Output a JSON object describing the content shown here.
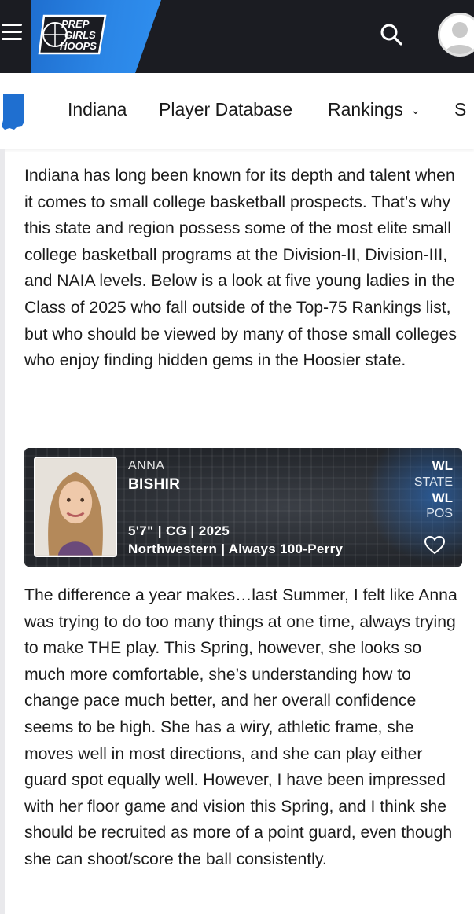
{
  "header": {
    "logo_lines": [
      "PREP",
      "GIRLS",
      "HOOPS"
    ],
    "icons": {
      "menu": "hamburger-menu-icon",
      "search": "search-icon",
      "account": "user-avatar-icon"
    },
    "colors": {
      "bar": "#1b1c22",
      "accent": "#2b86e6"
    }
  },
  "nav": {
    "state_icon": "indiana-state-icon",
    "items": [
      {
        "label": "Indiana"
      },
      {
        "label": "Player Database"
      },
      {
        "label": "Rankings"
      },
      {
        "label": "S"
      }
    ]
  },
  "article": {
    "intro": "Indiana has long been known for its depth and talent when it comes to small college basketball prospects. That’s why this state and region possess some of the most elite small college basketball programs at the Division-II, Division-III, and NAIA levels. Below is a look at five young ladies in the Class of 2025 who fall outside of the Top-75 Rankings list, but who should be viewed by many of those small colleges who enjoy finding hidden gems in the Hoosier state.",
    "player_card": {
      "first_name": "ANNA",
      "last_name": "BISHIR",
      "height_pos_class": "5'7\" | CG | 2025",
      "school_team": "Northwestern | Always 100-Perry",
      "state_rank_value": "WL",
      "state_rank_label": "STATE",
      "pos_rank_value": "WL",
      "pos_rank_label": "POS",
      "favorite_icon": "heart-icon"
    },
    "evaluation": "The difference a year makes…last Summer, I felt like Anna was trying to do too many things at one time, always trying to make THE play. This Spring, however, she looks so much more comfortable, she’s understanding how to change pace much better, and her overall confidence seems to be high. She has a wiry, athletic frame, she moves well in most directions, and she can play either guard spot equally well. However, I have been impressed with her floor game and vision this Spring, and I think she should be recruited as more of a point guard, even though she can shoot/score the ball consistently."
  }
}
